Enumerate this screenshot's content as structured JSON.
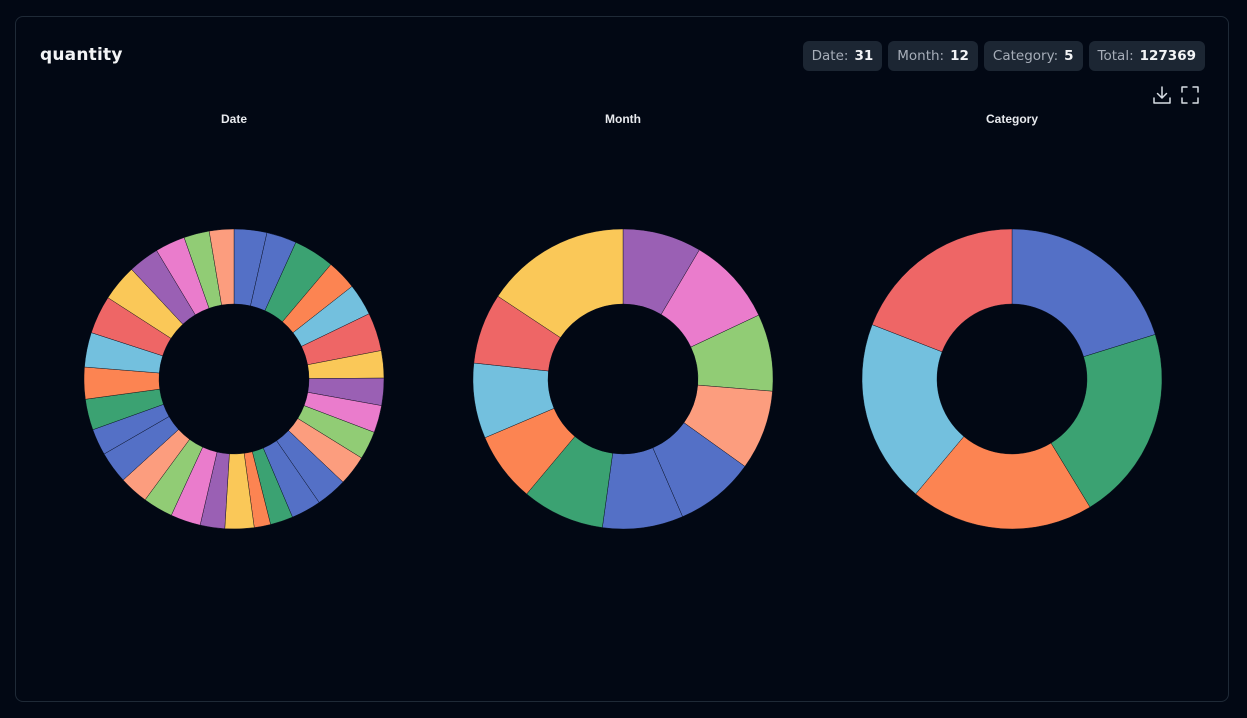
{
  "panel": {
    "title": "quantity",
    "badges": [
      {
        "label": "Date:",
        "value": "31"
      },
      {
        "label": "Month:",
        "value": "12"
      },
      {
        "label": "Category:",
        "value": "5"
      },
      {
        "label": "Total:",
        "value": "127369"
      }
    ],
    "tools": [
      "download-icon",
      "fullscreen-icon"
    ]
  },
  "palette": [
    "#5470c6",
    "#3ba272",
    "#fc8452",
    "#73c0de",
    "#ee6666",
    "#fac858",
    "#9a60b4",
    "#ea7ccc",
    "#91cc75",
    "#fc9d7e"
  ],
  "chart_data": [
    {
      "type": "pie",
      "donut": true,
      "title": "Date",
      "slices": [
        {
          "value": 3.6,
          "color": "#5470c6"
        },
        {
          "value": 3.3,
          "color": "#5470c6"
        },
        {
          "value": 4.5,
          "color": "#3ba272"
        },
        {
          "value": 3.3,
          "color": "#fc8452"
        },
        {
          "value": 3.5,
          "color": "#73c0de"
        },
        {
          "value": 4.2,
          "color": "#ee6666"
        },
        {
          "value": 3.0,
          "color": "#fac858"
        },
        {
          "value": 3.0,
          "color": "#9a60b4"
        },
        {
          "value": 3.0,
          "color": "#ea7ccc"
        },
        {
          "value": 3.1,
          "color": "#91cc75"
        },
        {
          "value": 3.3,
          "color": "#fc9d7e"
        },
        {
          "value": 3.4,
          "color": "#5470c6"
        },
        {
          "value": 3.3,
          "color": "#5470c6"
        },
        {
          "value": 2.5,
          "color": "#3ba272"
        },
        {
          "value": 1.8,
          "color": "#fc8452"
        },
        {
          "value": 3.2,
          "color": "#fac858"
        },
        {
          "value": 2.7,
          "color": "#9a60b4"
        },
        {
          "value": 3.3,
          "color": "#ea7ccc"
        },
        {
          "value": 3.3,
          "color": "#91cc75"
        },
        {
          "value": 3.2,
          "color": "#fc9d7e"
        },
        {
          "value": 3.5,
          "color": "#5470c6"
        },
        {
          "value": 2.9,
          "color": "#5470c6"
        },
        {
          "value": 3.4,
          "color": "#3ba272"
        },
        {
          "value": 3.5,
          "color": "#fc8452"
        },
        {
          "value": 3.8,
          "color": "#73c0de"
        },
        {
          "value": 4.2,
          "color": "#ee6666"
        },
        {
          "value": 4.0,
          "color": "#fac858"
        },
        {
          "value": 3.4,
          "color": "#9a60b4"
        },
        {
          "value": 3.3,
          "color": "#ea7ccc"
        },
        {
          "value": 2.8,
          "color": "#91cc75"
        },
        {
          "value": 2.7,
          "color": "#fc9d7e"
        }
      ]
    },
    {
      "type": "pie",
      "donut": true,
      "title": "Month",
      "slices": [
        {
          "value": 8.5,
          "color": "#9a60b4"
        },
        {
          "value": 9.5,
          "color": "#ea7ccc"
        },
        {
          "value": 8.3,
          "color": "#91cc75"
        },
        {
          "value": 8.6,
          "color": "#fc9d7e"
        },
        {
          "value": 8.6,
          "color": "#5470c6"
        },
        {
          "value": 8.7,
          "color": "#5470c6"
        },
        {
          "value": 8.9,
          "color": "#3ba272"
        },
        {
          "value": 7.5,
          "color": "#fc8452"
        },
        {
          "value": 8.1,
          "color": "#73c0de"
        },
        {
          "value": 7.6,
          "color": "#ee6666"
        },
        {
          "value": 15.7,
          "color": "#fac858"
        }
      ]
    },
    {
      "type": "pie",
      "donut": true,
      "title": "Category",
      "slices": [
        {
          "value": 20.2,
          "color": "#5470c6"
        },
        {
          "value": 21.1,
          "color": "#3ba272"
        },
        {
          "value": 19.8,
          "color": "#fc8452"
        },
        {
          "value": 19.8,
          "color": "#73c0de"
        },
        {
          "value": 19.1,
          "color": "#ee6666"
        }
      ]
    }
  ]
}
